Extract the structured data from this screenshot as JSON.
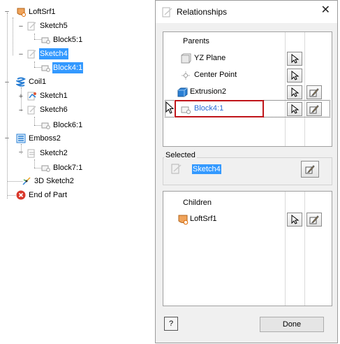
{
  "tree": {
    "items": [
      {
        "label": "LoftSrf1",
        "icon": "loft-surface-icon"
      },
      {
        "label": "Sketch5",
        "icon": "sketch-icon"
      },
      {
        "label": "Block5:1",
        "icon": "block-icon"
      },
      {
        "label": "Sketch4",
        "icon": "sketch-icon"
      },
      {
        "label": "Block4:1",
        "icon": "block-icon"
      },
      {
        "label": "Coil1",
        "icon": "coil-icon"
      },
      {
        "label": "Sketch1",
        "icon": "sketch-icon"
      },
      {
        "label": "Sketch6",
        "icon": "sketch-icon"
      },
      {
        "label": "Block6:1",
        "icon": "block-icon"
      },
      {
        "label": "Emboss2",
        "icon": "emboss-icon"
      },
      {
        "label": "Sketch2",
        "icon": "sketch-icon"
      },
      {
        "label": "Block7:1",
        "icon": "block-icon"
      },
      {
        "label": "3D Sketch2",
        "icon": "3d-sketch-icon"
      },
      {
        "label": "End of Part",
        "icon": "end-of-part-icon"
      }
    ],
    "expanders": {
      "expanded": "−",
      "collapsed": "+"
    }
  },
  "dialog": {
    "title": "Relationships",
    "close_glyph": "✕",
    "parents": {
      "header": "Parents",
      "rows": [
        {
          "label": "YZ Plane",
          "icon": "work-plane-icon"
        },
        {
          "label": "Center Point",
          "icon": "work-point-icon"
        },
        {
          "label": "Extrusion2",
          "icon": "extrusion-icon"
        },
        {
          "label": "Block4:1",
          "icon": "block-icon"
        }
      ]
    },
    "selected": {
      "label": "Selected",
      "value": "Sketch4"
    },
    "children": {
      "header": "Children",
      "rows": [
        {
          "label": "LoftSrf1",
          "icon": "loft-surface-icon"
        }
      ]
    },
    "help_glyph": "?",
    "done_label": "Done"
  },
  "colors": {
    "selection": "#3399ff",
    "highlight_box": "#c0151a",
    "dialog_bg": "#f0f0f0",
    "error_red": "#d9382b"
  }
}
